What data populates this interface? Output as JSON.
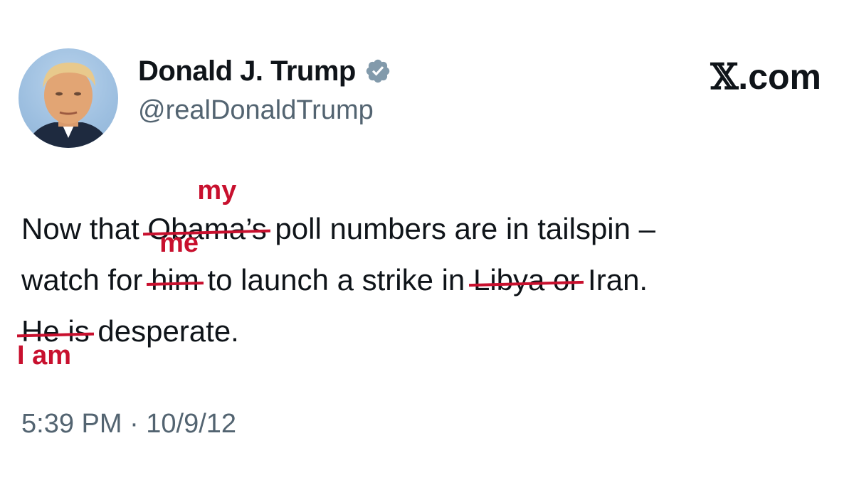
{
  "author": {
    "name": "Donald J. Trump",
    "handle": "@realDonaldTrump",
    "verified": true
  },
  "brand": {
    "x_glyph": "𝕏",
    "domain": ".com"
  },
  "tweet": {
    "line1": {
      "before": "Now that ",
      "struck": "Obama’s",
      "correction": "my",
      "after": " poll numbers are in tailspin –"
    },
    "line2": {
      "before": "watch for ",
      "struck1": "him",
      "correction": "me",
      "middle": " to launch a strike in ",
      "struck2": "Libya or",
      "after": " Iran."
    },
    "line3": {
      "struck": "He is",
      "correction": "I am",
      "after": " desperate."
    }
  },
  "timestamp": "5:39 PM · 10/9/12",
  "colors": {
    "text": "#0f1419",
    "muted": "#536471",
    "correction_red": "#c8102e",
    "verified_badge": "#829aab"
  }
}
